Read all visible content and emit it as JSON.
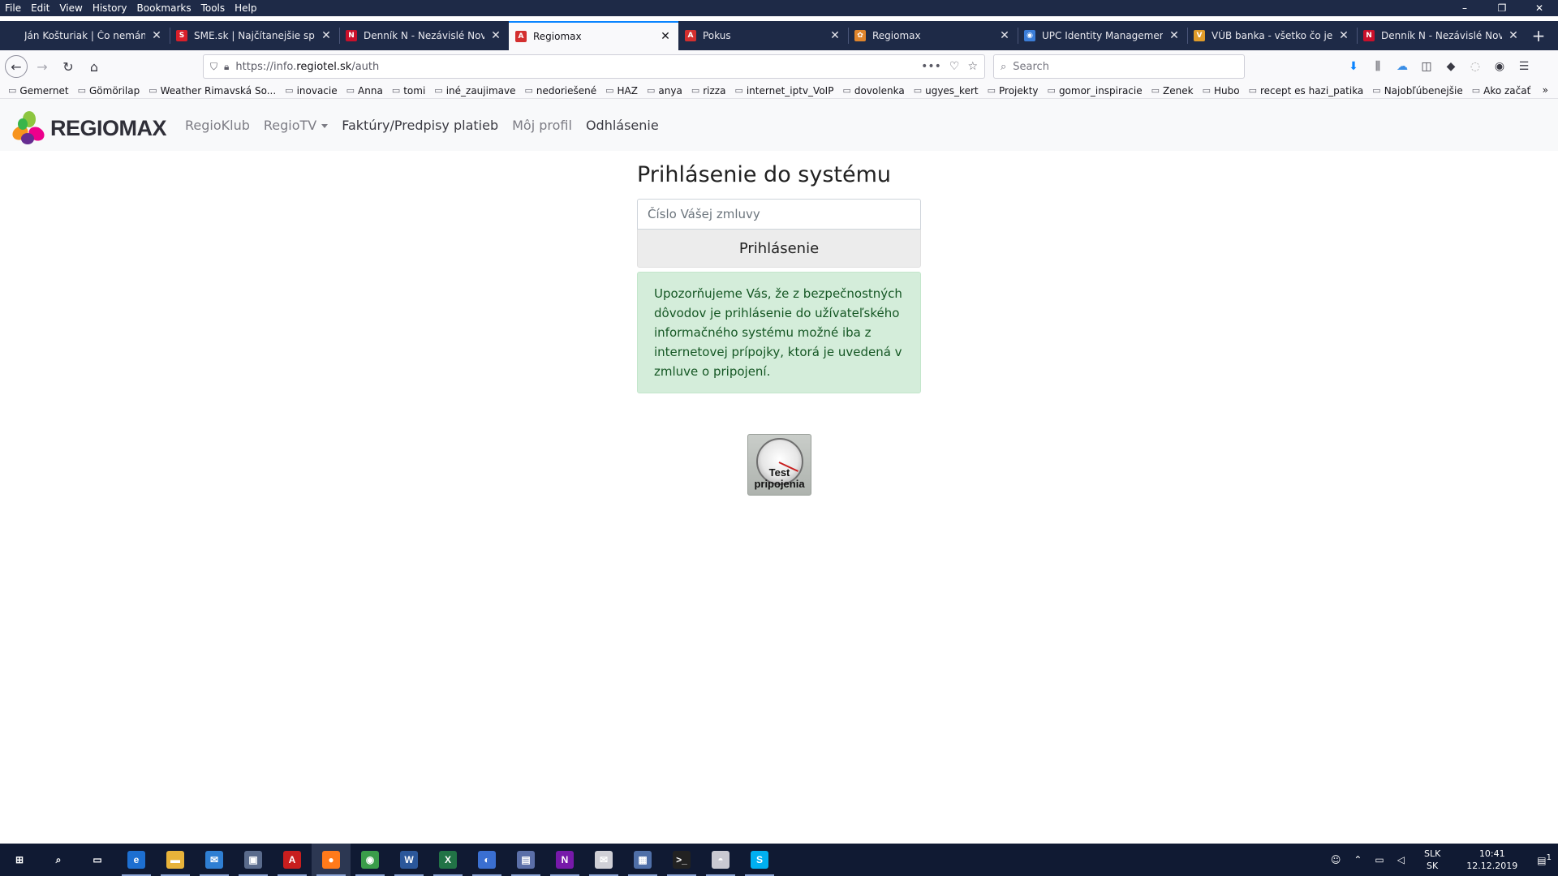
{
  "menu": [
    "File",
    "Edit",
    "View",
    "History",
    "Bookmarks",
    "Tools",
    "Help"
  ],
  "window": {
    "minimize": "–",
    "restore": "❐",
    "close": "✕"
  },
  "tabs": [
    {
      "label": "Ján Košturiak | Čo nemáme to nemôžeme",
      "icon": "",
      "iconColor": "#1e2a47"
    },
    {
      "label": "SME.sk | Najčítanejšie správy",
      "icon": "S",
      "iconColor": "#d91f2a"
    },
    {
      "label": "Denník N - Nezávislé Noviny",
      "icon": "N",
      "iconColor": "#c9102b"
    },
    {
      "label": "Regiomax",
      "icon": "A",
      "iconColor": "#d32f2f",
      "active": true
    },
    {
      "label": "Pokus",
      "icon": "A",
      "iconColor": "#d32f2f"
    },
    {
      "label": "Regiomax",
      "icon": "✿",
      "iconColor": "#e0852c"
    },
    {
      "label": "UPC Identity Management",
      "icon": "◉",
      "iconColor": "#3b7dd8"
    },
    {
      "label": "VÚB banka - všetko čo je možné",
      "icon": "V",
      "iconColor": "#e09c2a"
    },
    {
      "label": "Denník N - Nezávislé Noviny",
      "icon": "N",
      "iconColor": "#c9102b"
    }
  ],
  "newtab": "+",
  "url": {
    "prefix": "https://info.",
    "domain": "regiotel.sk",
    "path": "/auth"
  },
  "search": {
    "placeholder": "Search"
  },
  "bookmarks": [
    "Gemernet",
    "Gömörilap",
    "Weather Rimavská So...",
    "inovacie",
    "Anna",
    "tomi",
    "iné_zaujimave",
    "nedoriešené",
    "HAZ",
    "anya",
    "rizza",
    "internet_iptv_VoIP",
    "dovolenka",
    "ugyes_kert",
    "Projekty",
    "gomor_inspiracie",
    "Zenek",
    "Hubo",
    "recept es hazi_patika",
    "Najobľúbenejšie",
    "Ako začať"
  ],
  "site": {
    "logo": "REGIOMAX",
    "nav": [
      {
        "label": "RegioKlub",
        "dark": false
      },
      {
        "label": "RegioTV",
        "dark": false,
        "dropdown": true
      },
      {
        "label": "Faktúry/Predpisy platieb",
        "dark": true
      },
      {
        "label": "Môj profil",
        "dark": false
      },
      {
        "label": "Odhlásenie",
        "dark": true
      }
    ]
  },
  "login": {
    "title": "Prihlásenie do systému",
    "placeholder": "Číslo Vášej zmluvy",
    "button": "Prihlásenie",
    "notice": "Upozorňujeme Vás, že z bezpečnostných dôvodov je prihlásenie do užívateľského informačného systému možné iba z internetovej prípojky, ktorá je uvedená v zmluve o pripojení."
  },
  "speedtest": {
    "line1": "Test",
    "line2": "pripojenia"
  },
  "taskbar": {
    "apps": [
      {
        "name": "start",
        "glyph": "⊞",
        "color": "transparent"
      },
      {
        "name": "search",
        "glyph": "⌕",
        "color": "transparent"
      },
      {
        "name": "task-view",
        "glyph": "▭",
        "color": "transparent"
      },
      {
        "name": "edge",
        "glyph": "e",
        "color": "#1d6fd1"
      },
      {
        "name": "explorer",
        "glyph": "▬",
        "color": "#e8b33a"
      },
      {
        "name": "mail-app",
        "glyph": "✉",
        "color": "#2f7fd3"
      },
      {
        "name": "store",
        "glyph": "▣",
        "color": "#5a6b8c"
      },
      {
        "name": "acrobat",
        "glyph": "A",
        "color": "#c81e1e"
      },
      {
        "name": "firefox",
        "glyph": "●",
        "color": "#ff7a1a"
      },
      {
        "name": "chrome",
        "glyph": "◉",
        "color": "#3a9d4a"
      },
      {
        "name": "word",
        "glyph": "W",
        "color": "#2b579a"
      },
      {
        "name": "excel",
        "glyph": "X",
        "color": "#217346"
      },
      {
        "name": "chat",
        "glyph": "◐",
        "color": "#3a6fd1"
      },
      {
        "name": "network",
        "glyph": "▤",
        "color": "#5b6fa8"
      },
      {
        "name": "onenote",
        "glyph": "N",
        "color": "#7719aa"
      },
      {
        "name": "envelope",
        "glyph": "✉",
        "color": "#cfcfd6"
      },
      {
        "name": "remote",
        "glyph": "▦",
        "color": "#4f6fa8"
      },
      {
        "name": "terminal",
        "glyph": ">_",
        "color": "#222"
      },
      {
        "name": "paint",
        "glyph": "◓",
        "color": "#c9c9d1"
      },
      {
        "name": "skype",
        "glyph": "S",
        "color": "#00aff0"
      }
    ],
    "lang": {
      "top": "SLK",
      "bottom": "SK"
    },
    "clock": {
      "time": "10:41",
      "date": "12.12.2019"
    },
    "notif": "1"
  },
  "colors": {
    "accent": "#0a84ff",
    "alertBg": "#d4edda",
    "alertText": "#155724"
  }
}
